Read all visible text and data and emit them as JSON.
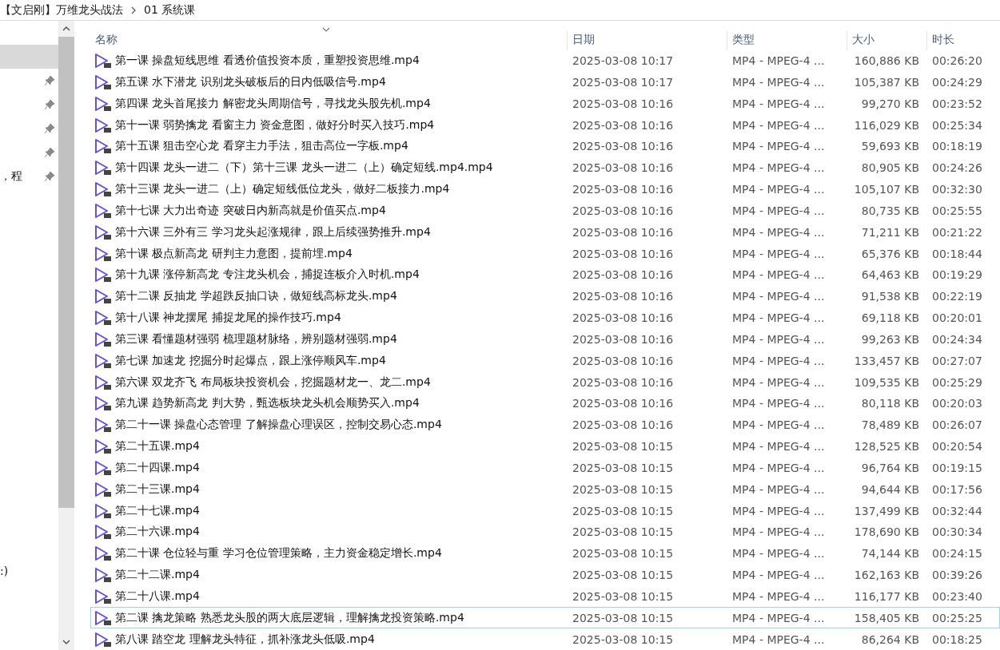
{
  "breadcrumb": {
    "items": [
      {
        "label": "【文启刚】万维龙头战法"
      },
      {
        "label": "01 系统课"
      }
    ]
  },
  "sidebar": {
    "items": [
      {
        "selected": true,
        "pinned": false
      },
      {
        "selected": false,
        "pinned": true
      },
      {
        "selected": false,
        "pinned": true
      },
      {
        "selected": false,
        "pinned": true
      },
      {
        "selected": false,
        "pinned": true
      },
      {
        "selected": false,
        "pinned": true,
        "label": "，程"
      },
      {
        "selected": false,
        "pinned": false,
        "label": ":)"
      }
    ]
  },
  "table": {
    "columns": [
      "名称",
      "日期",
      "类型",
      "大小",
      "时长"
    ],
    "rows": [
      {
        "selected": false,
        "name": "第一课 操盘短线思维 看透价值投资本质，重塑投资思维.mp4",
        "date": "2025-03-08 10:17",
        "type": "MP4 - MPEG-4 ...",
        "size": "160,886 KB",
        "duration": "00:26:20"
      },
      {
        "selected": false,
        "name": "第五课 水下潜龙 识别龙头破板后的日内低吸信号.mp4",
        "date": "2025-03-08 10:17",
        "type": "MP4 - MPEG-4 ...",
        "size": "105,387 KB",
        "duration": "00:24:29"
      },
      {
        "selected": false,
        "name": "第四课 龙头首尾接力 解密龙头周期信号，寻找龙头股先机.mp4",
        "date": "2025-03-08 10:16",
        "type": "MP4 - MPEG-4 ...",
        "size": "99,270 KB",
        "duration": "00:23:52"
      },
      {
        "selected": false,
        "name": "第十一课 弱势擒龙 看窗主力 资金意图，做好分时买入技巧.mp4",
        "date": "2025-03-08 10:16",
        "type": "MP4 - MPEG-4 ...",
        "size": "116,029 KB",
        "duration": "00:25:34"
      },
      {
        "selected": false,
        "name": "第十五课 狙击空心龙 看穿主力手法，狙击高位一字板.mp4",
        "date": "2025-03-08 10:16",
        "type": "MP4 - MPEG-4 ...",
        "size": "59,693 KB",
        "duration": "00:18:19"
      },
      {
        "selected": false,
        "name": "第十四课 龙头一进二（下）第十三课 龙头一进二（上）确定短线.mp4.mp4",
        "date": "2025-03-08 10:16",
        "type": "MP4 - MPEG-4 ...",
        "size": "80,905 KB",
        "duration": "00:24:26"
      },
      {
        "selected": false,
        "name": "第十三课 龙头一进二（上）确定短线低位龙头，做好二板接力.mp4",
        "date": "2025-03-08 10:16",
        "type": "MP4 - MPEG-4 ...",
        "size": "105,107 KB",
        "duration": "00:32:30"
      },
      {
        "selected": false,
        "name": "第十七课 大力出奇迹 突破日内新高就是价值买点.mp4",
        "date": "2025-03-08 10:16",
        "type": "MP4 - MPEG-4 ...",
        "size": "80,735 KB",
        "duration": "00:25:55"
      },
      {
        "selected": false,
        "name": "第十六课 三外有三 学习龙头起涨规律，跟上后续强势推升.mp4",
        "date": "2025-03-08 10:16",
        "type": "MP4 - MPEG-4 ...",
        "size": "71,211 KB",
        "duration": "00:21:22"
      },
      {
        "selected": false,
        "name": "第十课 极点新高龙 研判主力意图，提前埋.mp4",
        "date": "2025-03-08 10:16",
        "type": "MP4 - MPEG-4 ...",
        "size": "65,376 KB",
        "duration": "00:18:44"
      },
      {
        "selected": false,
        "name": "第十九课 涨停新高龙 专注龙头机会，捕捉连板介入时机.mp4",
        "date": "2025-03-08 10:16",
        "type": "MP4 - MPEG-4 ...",
        "size": "64,463 KB",
        "duration": "00:19:29"
      },
      {
        "selected": false,
        "name": "第十二课 反抽龙 学超跌反抽口诀，做短线高标龙头.mp4",
        "date": "2025-03-08 10:16",
        "type": "MP4 - MPEG-4 ...",
        "size": "91,538 KB",
        "duration": "00:22:19"
      },
      {
        "selected": false,
        "name": "第十八课 神龙摆尾 捕捉龙尾的操作技巧.mp4",
        "date": "2025-03-08 10:16",
        "type": "MP4 - MPEG-4 ...",
        "size": "69,118 KB",
        "duration": "00:20:01"
      },
      {
        "selected": false,
        "name": "第三课 看懂题材强弱 梳理题材脉络，辨别题材强弱.mp4",
        "date": "2025-03-08 10:16",
        "type": "MP4 - MPEG-4 ...",
        "size": "99,263 KB",
        "duration": "00:24:34"
      },
      {
        "selected": false,
        "name": "第七课 加速龙 挖掘分时起爆点，跟上涨停顺风车.mp4",
        "date": "2025-03-08 10:16",
        "type": "MP4 - MPEG-4 ...",
        "size": "133,457 KB",
        "duration": "00:27:07"
      },
      {
        "selected": false,
        "name": "第六课 双龙齐飞 布局板块投资机会，挖掘题材龙一、龙二.mp4",
        "date": "2025-03-08 10:16",
        "type": "MP4 - MPEG-4 ...",
        "size": "109,535 KB",
        "duration": "00:25:29"
      },
      {
        "selected": false,
        "name": "第九课 趋势新高龙 判大势，甄选板块龙头机会顺势买入.mp4",
        "date": "2025-03-08 10:16",
        "type": "MP4 - MPEG-4 ...",
        "size": "80,118 KB",
        "duration": "00:20:03"
      },
      {
        "selected": false,
        "name": "第二十一课 操盘心态管理 了解操盘心理误区，控制交易心态.mp4",
        "date": "2025-03-08 10:16",
        "type": "MP4 - MPEG-4 ...",
        "size": "78,489 KB",
        "duration": "00:26:07"
      },
      {
        "selected": false,
        "name": "第二十五课.mp4",
        "date": "2025-03-08 10:15",
        "type": "MP4 - MPEG-4 ...",
        "size": "128,525 KB",
        "duration": "00:20:54"
      },
      {
        "selected": false,
        "name": "第二十四课.mp4",
        "date": "2025-03-08 10:15",
        "type": "MP4 - MPEG-4 ...",
        "size": "96,764 KB",
        "duration": "00:19:15"
      },
      {
        "selected": false,
        "name": "第二十三课.mp4",
        "date": "2025-03-08 10:15",
        "type": "MP4 - MPEG-4 ...",
        "size": "94,644 KB",
        "duration": "00:17:56"
      },
      {
        "selected": false,
        "name": "第二十七课.mp4",
        "date": "2025-03-08 10:15",
        "type": "MP4 - MPEG-4 ...",
        "size": "137,499 KB",
        "duration": "00:32:44"
      },
      {
        "selected": false,
        "name": "第二十六课.mp4",
        "date": "2025-03-08 10:15",
        "type": "MP4 - MPEG-4 ...",
        "size": "178,690 KB",
        "duration": "00:30:34"
      },
      {
        "selected": false,
        "name": "第二十课 仓位轻与重 学习仓位管理策略，主力资金稳定增长.mp4",
        "date": "2025-03-08 10:15",
        "type": "MP4 - MPEG-4 ...",
        "size": "74,144 KB",
        "duration": "00:24:15"
      },
      {
        "selected": false,
        "name": "第二十二课.mp4",
        "date": "2025-03-08 10:15",
        "type": "MP4 - MPEG-4 ...",
        "size": "162,163 KB",
        "duration": "00:39:26"
      },
      {
        "selected": false,
        "name": "第二十八课.mp4",
        "date": "2025-03-08 10:15",
        "type": "MP4 - MPEG-4 ...",
        "size": "116,177 KB",
        "duration": "00:23:40"
      },
      {
        "selected": true,
        "name": "第二课 擒龙策略 熟悉龙头股的两大底层逻辑，理解擒龙投资策略.mp4",
        "date": "2025-03-08 10:15",
        "type": "MP4 - MPEG-4 ...",
        "size": "158,405 KB",
        "duration": "00:25:25"
      },
      {
        "selected": false,
        "name": "第八课 踏空龙 理解龙头特征，抓补涨龙头低吸.mp4",
        "date": "2025-03-08 10:15",
        "type": "MP4 - MPEG-4 ...",
        "size": "86,264 KB",
        "duration": "00:18:25"
      }
    ]
  }
}
